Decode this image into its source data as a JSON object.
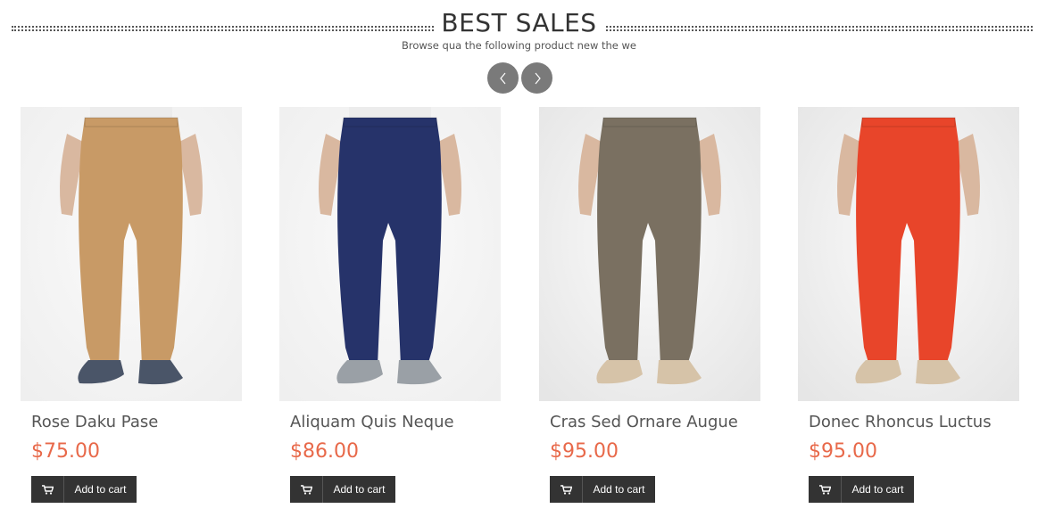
{
  "section": {
    "title": "BEST SALES",
    "subtitle": "Browse qua the following product new the we"
  },
  "carousel": {
    "prev_icon": "chevron-left-icon",
    "next_icon": "chevron-right-icon"
  },
  "colors": {
    "price": "#e8694a",
    "button_bg": "#333333",
    "nav_bg": "#7a7a7a"
  },
  "products": [
    {
      "name": "Rose Daku Pase",
      "price": "$75.00",
      "button_label": "Add to cart",
      "pants_color": "#c89a66",
      "shoe_color": "#4a5568",
      "image": "khaki-chinos-photo"
    },
    {
      "name": "Aliquam Quis Neque",
      "price": "$86.00",
      "button_label": "Add to cart",
      "pants_color": "#26336a",
      "shoe_color": "#9aa0a6",
      "image": "navy-chinos-photo"
    },
    {
      "name": "Cras Sed Ornare Augue",
      "price": "$95.00",
      "button_label": "Add to cart",
      "pants_color": "#7a7061",
      "shoe_color": "#d6c3a8",
      "image": "grey-trousers-photo"
    },
    {
      "name": "Donec Rhoncus Luctus",
      "price": "$95.00",
      "button_label": "Add to cart",
      "pants_color": "#e8452a",
      "shoe_color": "#d6c3a8",
      "image": "red-chinos-photo"
    }
  ]
}
